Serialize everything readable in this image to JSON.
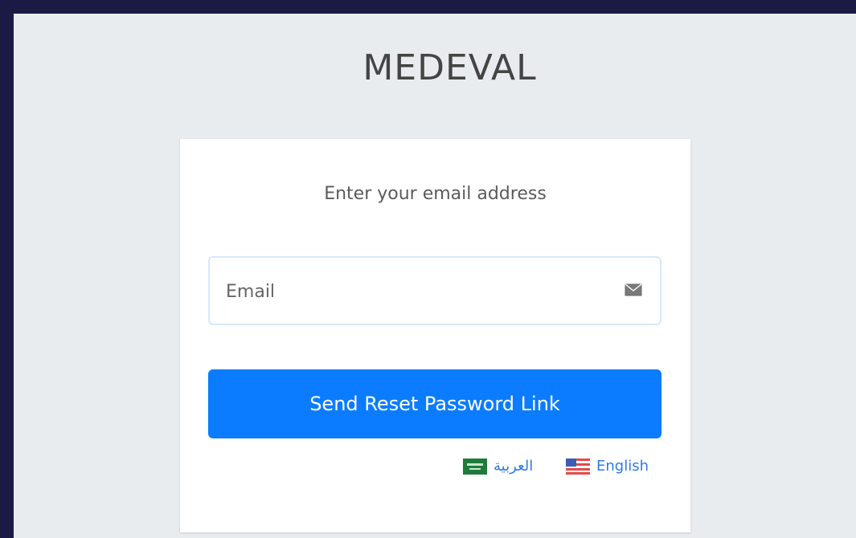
{
  "brand": {
    "name": "MEDEVAL"
  },
  "card": {
    "title": "Enter your email address",
    "email": {
      "value": "",
      "placeholder": "Email",
      "icon": "envelope-icon"
    },
    "submit_label": "Send Reset Password Link"
  },
  "languages": [
    {
      "label": "العربية",
      "flag_icon": "saudi-flag-icon"
    },
    {
      "label": "English",
      "flag_icon": "us-flag-icon"
    }
  ],
  "colors": {
    "accent": "#0b7cff",
    "frame": "#1b1a45",
    "background": "#e9ecef",
    "link": "#2e7be6"
  }
}
